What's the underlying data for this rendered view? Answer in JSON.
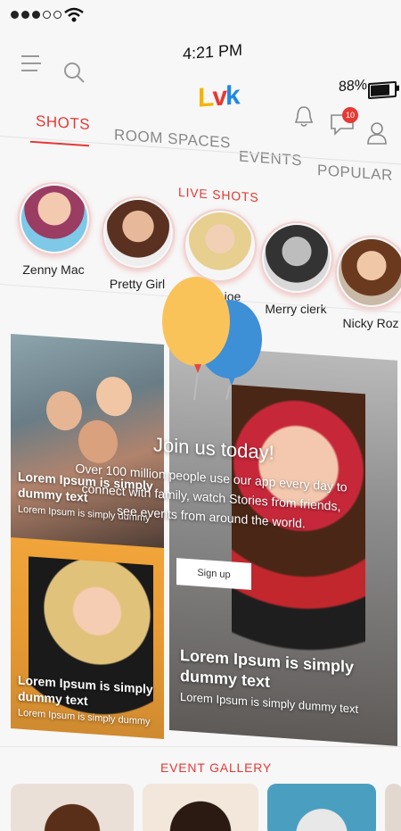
{
  "status": {
    "time": "4:21 PM",
    "battery": "88%",
    "battery_level": 0.88,
    "signal_bars": 3,
    "signal_total": 5
  },
  "header": {
    "logo": "Lvk",
    "logo_parts": [
      "L",
      "v",
      "k"
    ],
    "notification_count": "10"
  },
  "tabs": [
    {
      "label": "SHOTS",
      "active": true
    },
    {
      "label": "ROOM SPACES",
      "active": false
    },
    {
      "label": "EVENTS",
      "active": false
    },
    {
      "label": "POPULAR",
      "active": false
    }
  ],
  "live_shots": {
    "title": "LIVE SHOTS",
    "stories": [
      {
        "name": "Zenny Mac"
      },
      {
        "name": "Pretty Girl"
      },
      {
        "name": "joe"
      },
      {
        "name": "Merry clerk"
      },
      {
        "name": "Nicky Roz"
      }
    ]
  },
  "cards": [
    {
      "title": "Lorem Ipsum is simply dummy text",
      "subtitle": "Lorem Ipsum is simply dummy"
    },
    {
      "title": "Lorem Ipsum is simply dummy text",
      "subtitle": "Lorem Ipsum is simply dummy"
    },
    {
      "title": "Lorem Ipsum is simply dummy text",
      "subtitle": "Lorem Ipsum is simply dummy text"
    }
  ],
  "join": {
    "title": "Join us today!",
    "description": "Over 100 million people use our app every day to connect with family, watch Stories from friends, see events from around the world.",
    "button": "Sign up"
  },
  "event_gallery": {
    "title": "EVENT GALLERY"
  },
  "colors": {
    "accent": "#e53935",
    "balloon_yellow": "#f9c35a",
    "balloon_blue": "#3d8fd6"
  }
}
